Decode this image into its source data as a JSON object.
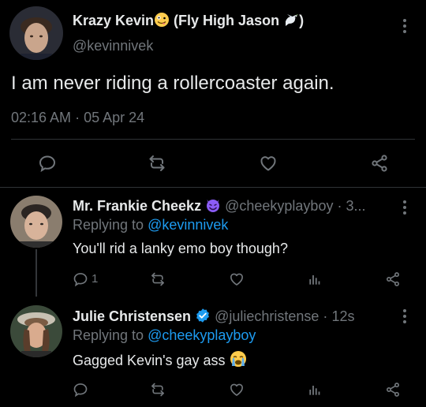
{
  "main_tweet": {
    "display_name": "Krazy Kevin",
    "name_suffix": " (Fly High Jason ",
    "name_close": ")",
    "handle": "@kevinnivek",
    "text": "I am never riding a rollercoaster again.",
    "time": "02:16 AM",
    "separator": "·",
    "date": "05 Apr 24"
  },
  "replies": [
    {
      "display_name": "Mr. Frankie Cheekz",
      "handle": "@cheekyplayboy",
      "time_sep": "·",
      "time": "3...",
      "replying_prefix": "Replying to",
      "replying_to": "@kevinnivek",
      "text": "You'll rid a lanky emo boy though?",
      "reply_count": "1"
    },
    {
      "display_name": "Julie Christensen",
      "handle": "@juliechristense",
      "time_sep": "·",
      "time": "12s",
      "replying_prefix": "Replying to",
      "replying_to": "@cheekyplayboy",
      "text": "Gagged Kevin's gay ass"
    }
  ],
  "colors": {
    "background": "#000000",
    "text": "#e7e9ea",
    "muted": "#71767b",
    "link": "#1d9bf0",
    "divider": "#2f3336",
    "verified": "#1d9bf0",
    "devil": "#8b5cf6"
  },
  "icons": [
    "more-icon",
    "reply-icon",
    "retweet-icon",
    "like-icon",
    "share-icon",
    "analytics-icon",
    "verified-badge-icon",
    "dove-emoji",
    "zany-face-emoji",
    "smiling-devil-emoji",
    "crying-face-emoji"
  ]
}
